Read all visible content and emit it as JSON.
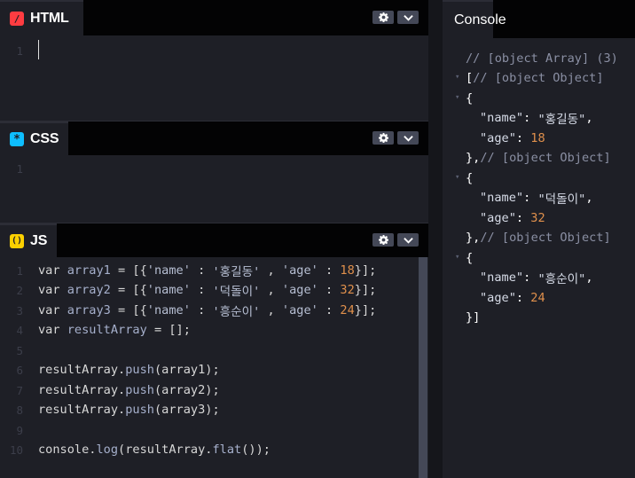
{
  "panels": {
    "html": {
      "label": "HTML",
      "badge": "/",
      "badge_color": "#ff3c41",
      "line_numbers": [
        "1"
      ]
    },
    "css": {
      "label": "CSS",
      "badge": "*",
      "badge_color": "#0ebeff",
      "line_numbers": [
        "1"
      ]
    },
    "js": {
      "label": "JS",
      "badge": "()",
      "badge_color": "#fcd000",
      "line_numbers": [
        "1",
        "2",
        "3",
        "4",
        "5",
        "6",
        "7",
        "8",
        "9",
        "10"
      ],
      "code": {
        "l1": {
          "kw": "var",
          "name": "array1",
          "eq": " = ",
          "open": "[{",
          "k1": "'name'",
          "c1": " : ",
          "v1": "'홍길동'",
          "sep": " , ",
          "k2": "'age'",
          "c2": " : ",
          "n": "18",
          "close": "}];"
        },
        "l2": {
          "kw": "var",
          "name": "array2",
          "eq": " = ",
          "open": "[{",
          "k1": "'name'",
          "c1": " : ",
          "v1": "'덕돌이'",
          "sep": " , ",
          "k2": "'age'",
          "c2": " : ",
          "n": "32",
          "close": "}];"
        },
        "l3": {
          "kw": "var",
          "name": "array3",
          "eq": " = ",
          "open": "[{",
          "k1": "'name'",
          "c1": " : ",
          "v1": "'흥순이'",
          "sep": " , ",
          "k2": "'age'",
          "c2": " : ",
          "n": "24",
          "close": "}];"
        },
        "l4": {
          "kw": "var",
          "name": "resultArray",
          "rest": " = [];"
        },
        "l6": {
          "obj": "resultArray",
          "dot": ".",
          "fn": "push",
          "arg": "(array1);"
        },
        "l7": {
          "obj": "resultArray",
          "dot": ".",
          "fn": "push",
          "arg": "(array2);"
        },
        "l8": {
          "obj": "resultArray",
          "dot": ".",
          "fn": "push",
          "arg": "(array3);"
        },
        "l10": {
          "obj": "console",
          "dot": ".",
          "fn": "log",
          "open": "(resultArray.",
          "fn2": "flat",
          "close": "());"
        }
      }
    }
  },
  "console": {
    "title": "Console",
    "lines": {
      "header": "// [object Array] (3)",
      "open_bracket": "[",
      "obj_comment": "// [object Object]",
      "brace_open": "{",
      "brace_close": "},",
      "close_bracket": "}]",
      "name_key": "\"name\"",
      "age_key": "\"age\"",
      "colon": ": ",
      "comma": ",",
      "items": [
        {
          "name": "\"홍길동\"",
          "age": "18"
        },
        {
          "name": "\"덕돌이\"",
          "age": "32"
        },
        {
          "name": "\"흥순이\"",
          "age": "24"
        }
      ]
    }
  },
  "icons": {
    "settings": "gear-icon",
    "collapse": "chevron-down-icon",
    "caret": "caret-down-icon"
  }
}
